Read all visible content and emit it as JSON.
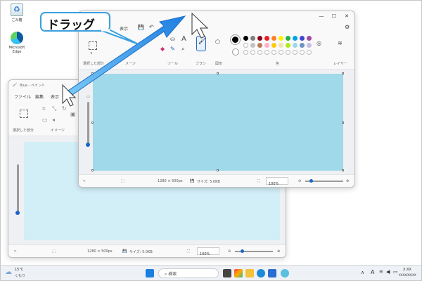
{
  "desktop": {
    "icons": [
      {
        "name": "recycle-bin",
        "label": "ごみ箱"
      },
      {
        "name": "microsoft-edge",
        "label": "Microsoft Edge"
      }
    ]
  },
  "callout": {
    "text": "ドラッグ"
  },
  "back_window": {
    "title": "Blue - ペイント",
    "menu": [
      "ファイル",
      "編集",
      "表示"
    ],
    "groups": {
      "select": "選択した部分",
      "image": "イメージ"
    },
    "status": {
      "size": "1280 × 500px",
      "file_size": "サイズ: 5.0KB",
      "zoom": "100%"
    }
  },
  "front_window": {
    "menu": [
      "表示"
    ],
    "groups": {
      "select": "選択した部分",
      "image": "メージ",
      "tools": "ツール",
      "brush": "ブラシ",
      "shapes": "図形",
      "colors": "色",
      "layers": "レイヤー"
    },
    "status": {
      "size": "1280 × 500px",
      "file_size": "サイズ: 5.0KB",
      "zoom": "100%"
    },
    "palette": {
      "row1": [
        "#000000",
        "#7f7f7f",
        "#880015",
        "#ed1c24",
        "#ff7f27",
        "#fff200",
        "#22b14c",
        "#00a2e8",
        "#3f48cc",
        "#a349a4"
      ],
      "row2": [
        "#ffffff",
        "#c3c3c3",
        "#b97a57",
        "#ffaec9",
        "#ffc90e",
        "#efe4b0",
        "#b5e61d",
        "#99d9ea",
        "#7092be",
        "#c8bfe7"
      ]
    },
    "canvas_color": "#9fd9ea"
  },
  "taskbar": {
    "weather_temp": "15°C",
    "weather_desc": "くもり",
    "search_placeholder": "検索",
    "ime": "A",
    "time": "X:XX",
    "date": "XXXX/XX/XX"
  },
  "colors": {
    "accent": "#1a66c8",
    "arrow": "#1e90e8",
    "callout_border": "#3aa0e0"
  }
}
